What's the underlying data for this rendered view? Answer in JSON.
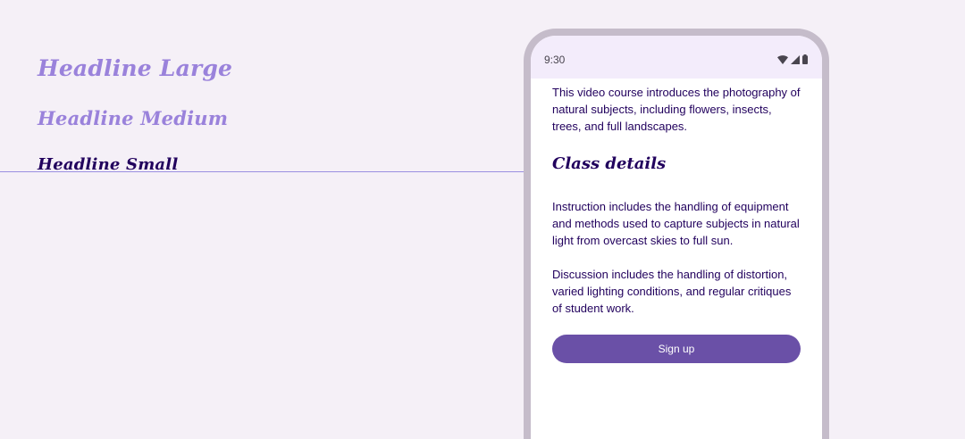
{
  "type_samples": {
    "headline_large": "Headline Large",
    "headline_medium": "Headline Medium",
    "headline_small": "Headline Small"
  },
  "phone": {
    "status_bar": {
      "time": "9:30",
      "icons": [
        "wifi-icon",
        "cellular-signal-icon",
        "battery-icon"
      ]
    },
    "intro_text": "This video course introduces the photography of natural subjects, including flowers, insects, trees, and full landscapes.",
    "section_heading": "Class details",
    "paragraphs": [
      "Instruction includes the handling of equipment and methods used to capture subjects in natural light from overcast skies to full sun.",
      "Discussion includes the handling of distortion, varied lighting conditions, and regular critiques of student work."
    ],
    "button_label": "Sign up"
  },
  "colors": {
    "background": "#f5f0f7",
    "headline_light": "#9a82db",
    "headline_dark": "#21005d",
    "button": "#6a50a7",
    "phone_frame": "#c5bcca",
    "status_bar": "#f3ecfb"
  }
}
